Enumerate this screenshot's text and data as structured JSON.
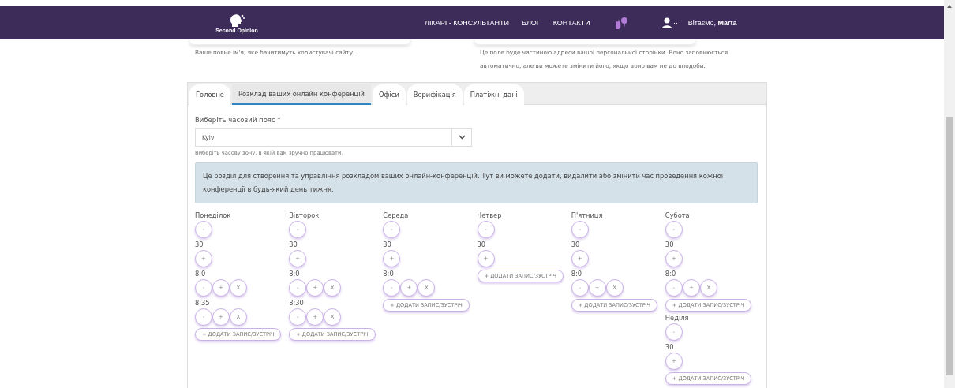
{
  "header": {
    "logo_text": "Second Opinion",
    "nav": [
      "ЛІКАРІ - КОНСУЛЬТАНТИ",
      "БЛОГ",
      "КОНТАКТИ"
    ],
    "greeting": "Вітаємо, **Marta**"
  },
  "profile_fields": [
    {
      "hint": "Ваше повне ім'я, яке бачитимуть користувачі сайту."
    },
    {
      "hint": "Це поле буде частиною адреси вашої персональної сторінки. Воно заповнюється автоматично, але ви можете змінити його, якщо воно вам не до вподоби."
    }
  ],
  "tabs": [
    {
      "label": "Головне",
      "selected": false
    },
    {
      "label": "Розклад ваших онлайн конференцій",
      "selected": true
    },
    {
      "label": "Офіси",
      "selected": false
    },
    {
      "label": "Верифікація",
      "selected": false
    },
    {
      "label": "Платіжні дані",
      "selected": false
    }
  ],
  "timezone": {
    "label": "Виберіть часовий пояс *",
    "value": "Kyiv",
    "hint": "Виберіть часову зону, в якій вам зручно працювати."
  },
  "info": "Це розділ для створення та управління розкладом ваших онлайн-конференцій. Тут ви можете додати, видалити або змінити час проведення кожної конференції в будь-який день тижня.",
  "columns": [
    {
      "days": [
        {
          "name": "Понеділок",
          "minus": "-",
          "duration": "30",
          "plus": "+",
          "slots": [
            {
              "time": "8:0",
              "buttons": [
                "-",
                "+",
                "X"
              ]
            },
            {
              "time": "8:35",
              "buttons": [
                "-",
                "+",
                "X"
              ]
            }
          ],
          "add_button": "+ ДОДАТИ ЗАПИС/ЗУСТРІЧ"
        }
      ]
    },
    {
      "days": [
        {
          "name": "Вівторок",
          "minus": "-",
          "duration": "30",
          "plus": "+",
          "slots": [
            {
              "time": "8:0",
              "buttons": [
                "-",
                "+",
                "X"
              ]
            },
            {
              "time": "8:30",
              "buttons": [
                "-",
                "+",
                "X"
              ]
            }
          ],
          "add_button": "+ ДОДАТИ ЗАПИС/ЗУСТРІЧ"
        }
      ]
    },
    {
      "days": [
        {
          "name": "Середа",
          "minus": "-",
          "duration": "30",
          "plus": "+",
          "slots": [
            {
              "time": "8:0",
              "buttons": [
                "-",
                "+",
                "X"
              ]
            }
          ],
          "add_button": "+ ДОДАТИ ЗАПИС/ЗУСТРІЧ"
        }
      ]
    },
    {
      "days": [
        {
          "name": "Четвер",
          "minus": "-",
          "duration": "30",
          "plus": "+",
          "add_button": "+ ДОДАТИ ЗАПИС/ЗУСТРІЧ"
        }
      ]
    },
    {
      "days": [
        {
          "name": "П'ятниця",
          "minus": "-",
          "duration": "30",
          "plus": "+",
          "slots": [
            {
              "time": "8:0",
              "buttons": [
                "-",
                "+",
                "X"
              ]
            }
          ],
          "add_button": "+ ДОДАТИ ЗАПИС/ЗУСТРІЧ"
        }
      ]
    },
    {
      "days": [
        {
          "name": "Субота",
          "minus": "-",
          "duration": "30",
          "plus": "+",
          "slots": [
            {
              "time": "8:0",
              "buttons": [
                "-",
                "+",
                "X"
              ]
            }
          ],
          "add_button": "+ ДОДАТИ ЗАПИС/ЗУСТРІЧ"
        },
        {
          "name": "Неділя",
          "minus": "-",
          "duration": "30",
          "plus": "+",
          "add_button": "+ ДОДАТИ ЗАПИС/ЗУСТРІЧ"
        }
      ]
    }
  ]
}
